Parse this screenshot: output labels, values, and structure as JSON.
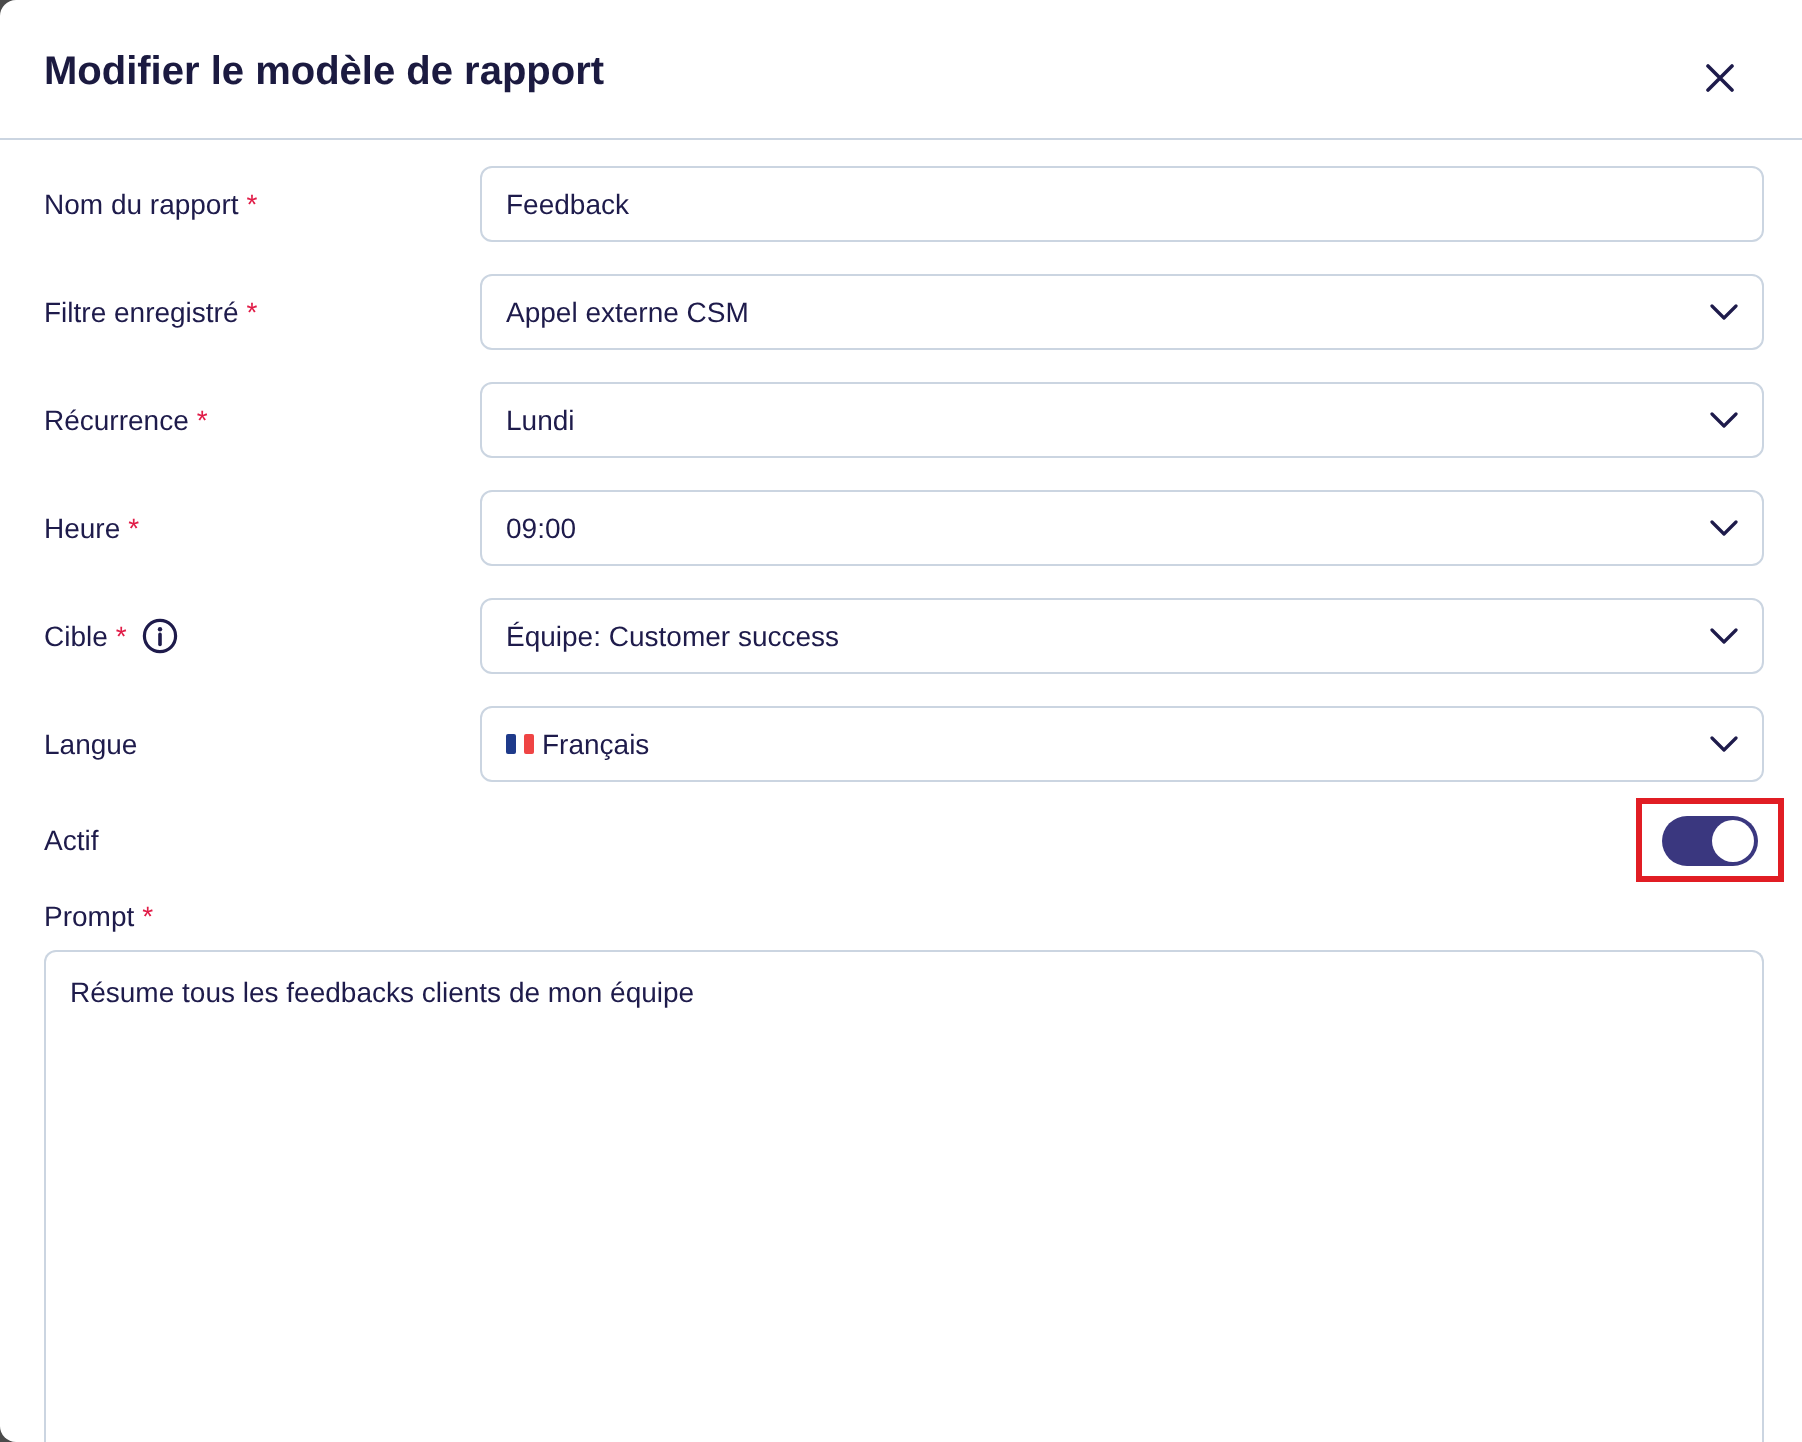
{
  "dialog": {
    "title": "Modifier le modèle de rapport"
  },
  "fields": [
    {
      "kind": "text",
      "label": "Nom du rapport",
      "asterisk": "*",
      "info": false,
      "value": "Feedback"
    },
    {
      "kind": "select",
      "label": "Filtre enregistré",
      "asterisk": "*",
      "info": false,
      "value": "Appel externe CSM"
    },
    {
      "kind": "select",
      "label": "Récurrence",
      "asterisk": "*",
      "info": false,
      "value": "Lundi"
    },
    {
      "kind": "select",
      "label": "Heure",
      "asterisk": "*",
      "info": false,
      "value": "09:00"
    },
    {
      "kind": "select",
      "label": "Cible",
      "asterisk": "*",
      "info": true,
      "value": "Équipe: Customer success"
    },
    {
      "kind": "language",
      "label": "Langue",
      "info": false,
      "value": "Français"
    }
  ],
  "toggle": {
    "label": "Actif",
    "on": true,
    "highlighted": true
  },
  "prompt": {
    "label": "Prompt",
    "asterisk": "*",
    "value": "Résume tous les feedbacks clients de mon équipe"
  }
}
